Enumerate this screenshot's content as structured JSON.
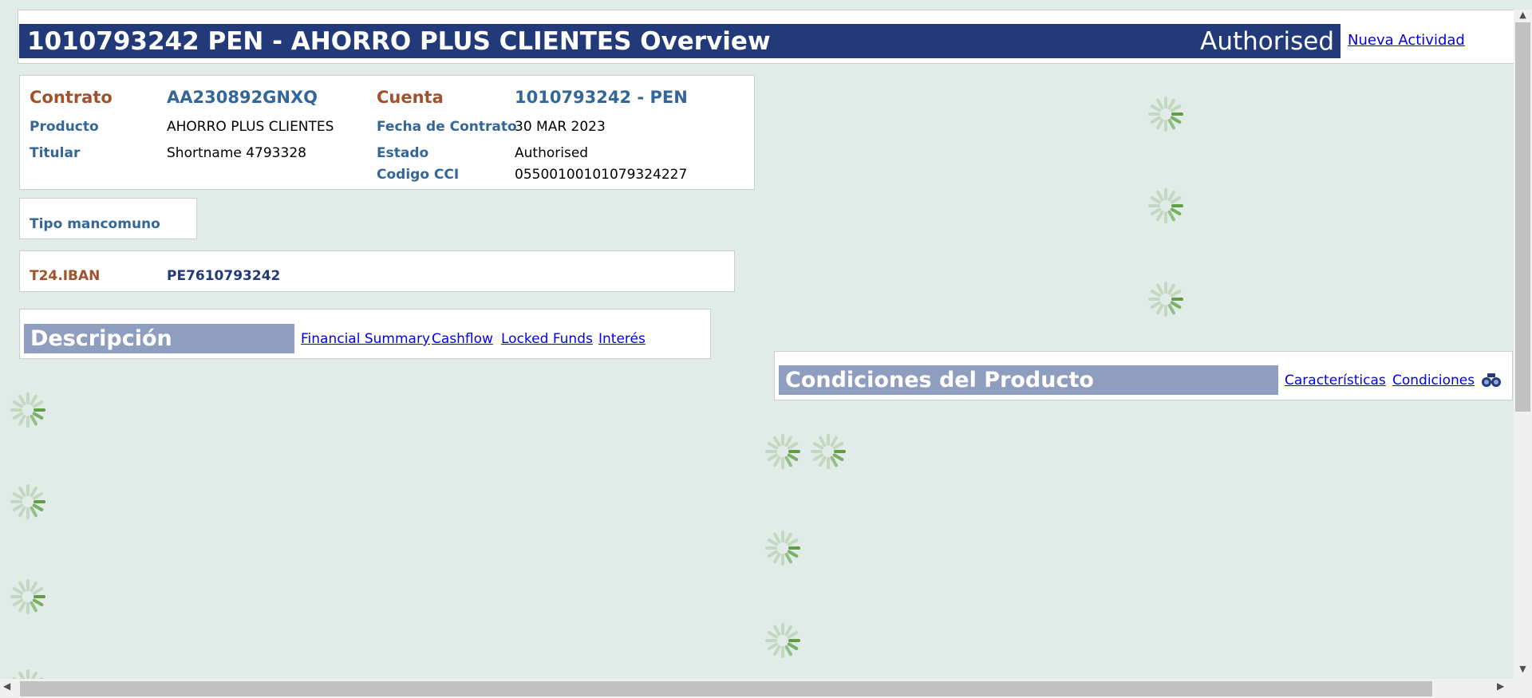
{
  "header": {
    "title": "1010793242 PEN - AHORRO PLUS CLIENTES Overview",
    "status": "Authorised",
    "action_link": "Nueva Actividad"
  },
  "contract": {
    "contrato_label": "Contrato",
    "contrato_value": "AA230892GNXQ",
    "cuenta_label": "Cuenta",
    "cuenta_value": "1010793242 - PEN",
    "producto_label": "Producto",
    "producto_value": "AHORRO PLUS CLIENTES",
    "fecha_label": "Fecha de Contrato",
    "fecha_value": "30 MAR 2023",
    "titular_label": "Titular",
    "titular_value": "Shortname 4793328",
    "estado_label": "Estado",
    "estado_value": "Authorised",
    "cci_label": "Codigo CCI",
    "cci_value": "05500100101079324227"
  },
  "joint": {
    "label": "Tipo mancomuno"
  },
  "iban": {
    "label": "T24.IBAN",
    "value": "PE7610793242"
  },
  "description": {
    "title": "Descripción",
    "tabs": [
      "Financial Summary",
      "Cashflow",
      "Locked Funds",
      "Interés"
    ]
  },
  "conditions": {
    "title": "Condiciones del Producto",
    "tabs": [
      "Características",
      "Condiciones"
    ],
    "search_icon": "binoculars-icon"
  },
  "colors": {
    "header_bg": "#223a7a",
    "section_bg": "#8f9dbf",
    "label_blue": "#336699",
    "label_brown": "#a0522d",
    "page_bg": "#e1ebe8",
    "spinner": "#5a9a3a"
  }
}
